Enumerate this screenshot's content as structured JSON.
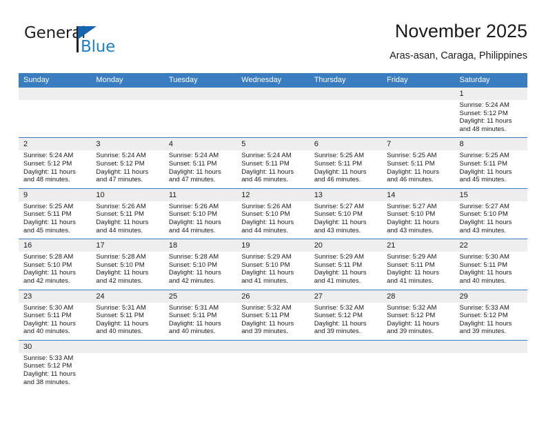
{
  "logo": {
    "primary_text": "General",
    "secondary_text": "Blue",
    "primary_color": "#231f20",
    "secondary_color": "#1f7fc4",
    "triangle_color": "#1565b0",
    "icon": "general-blue-logo"
  },
  "header": {
    "title": "November 2025",
    "subtitle": "Aras-asan, Caraga, Philippines"
  },
  "theme": {
    "header_bg": "#3a7dc1",
    "daynum_bg": "#eeeeee",
    "grid_line": "#3a7dc1",
    "text": "#1a1a1a"
  },
  "weekday_headers": [
    "Sunday",
    "Monday",
    "Tuesday",
    "Wednesday",
    "Thursday",
    "Friday",
    "Saturday"
  ],
  "weeks": [
    [
      {
        "day": "",
        "sunrise": "",
        "sunset": "",
        "daylight_line1": "",
        "daylight_line2": ""
      },
      {
        "day": "",
        "sunrise": "",
        "sunset": "",
        "daylight_line1": "",
        "daylight_line2": ""
      },
      {
        "day": "",
        "sunrise": "",
        "sunset": "",
        "daylight_line1": "",
        "daylight_line2": ""
      },
      {
        "day": "",
        "sunrise": "",
        "sunset": "",
        "daylight_line1": "",
        "daylight_line2": ""
      },
      {
        "day": "",
        "sunrise": "",
        "sunset": "",
        "daylight_line1": "",
        "daylight_line2": ""
      },
      {
        "day": "",
        "sunrise": "",
        "sunset": "",
        "daylight_line1": "",
        "daylight_line2": ""
      },
      {
        "day": "1",
        "sunrise": "Sunrise: 5:24 AM",
        "sunset": "Sunset: 5:12 PM",
        "daylight_line1": "Daylight: 11 hours",
        "daylight_line2": "and 48 minutes."
      }
    ],
    [
      {
        "day": "2",
        "sunrise": "Sunrise: 5:24 AM",
        "sunset": "Sunset: 5:12 PM",
        "daylight_line1": "Daylight: 11 hours",
        "daylight_line2": "and 48 minutes."
      },
      {
        "day": "3",
        "sunrise": "Sunrise: 5:24 AM",
        "sunset": "Sunset: 5:12 PM",
        "daylight_line1": "Daylight: 11 hours",
        "daylight_line2": "and 47 minutes."
      },
      {
        "day": "4",
        "sunrise": "Sunrise: 5:24 AM",
        "sunset": "Sunset: 5:11 PM",
        "daylight_line1": "Daylight: 11 hours",
        "daylight_line2": "and 47 minutes."
      },
      {
        "day": "5",
        "sunrise": "Sunrise: 5:24 AM",
        "sunset": "Sunset: 5:11 PM",
        "daylight_line1": "Daylight: 11 hours",
        "daylight_line2": "and 46 minutes."
      },
      {
        "day": "6",
        "sunrise": "Sunrise: 5:25 AM",
        "sunset": "Sunset: 5:11 PM",
        "daylight_line1": "Daylight: 11 hours",
        "daylight_line2": "and 46 minutes."
      },
      {
        "day": "7",
        "sunrise": "Sunrise: 5:25 AM",
        "sunset": "Sunset: 5:11 PM",
        "daylight_line1": "Daylight: 11 hours",
        "daylight_line2": "and 46 minutes."
      },
      {
        "day": "8",
        "sunrise": "Sunrise: 5:25 AM",
        "sunset": "Sunset: 5:11 PM",
        "daylight_line1": "Daylight: 11 hours",
        "daylight_line2": "and 45 minutes."
      }
    ],
    [
      {
        "day": "9",
        "sunrise": "Sunrise: 5:25 AM",
        "sunset": "Sunset: 5:11 PM",
        "daylight_line1": "Daylight: 11 hours",
        "daylight_line2": "and 45 minutes."
      },
      {
        "day": "10",
        "sunrise": "Sunrise: 5:26 AM",
        "sunset": "Sunset: 5:11 PM",
        "daylight_line1": "Daylight: 11 hours",
        "daylight_line2": "and 44 minutes."
      },
      {
        "day": "11",
        "sunrise": "Sunrise: 5:26 AM",
        "sunset": "Sunset: 5:10 PM",
        "daylight_line1": "Daylight: 11 hours",
        "daylight_line2": "and 44 minutes."
      },
      {
        "day": "12",
        "sunrise": "Sunrise: 5:26 AM",
        "sunset": "Sunset: 5:10 PM",
        "daylight_line1": "Daylight: 11 hours",
        "daylight_line2": "and 44 minutes."
      },
      {
        "day": "13",
        "sunrise": "Sunrise: 5:27 AM",
        "sunset": "Sunset: 5:10 PM",
        "daylight_line1": "Daylight: 11 hours",
        "daylight_line2": "and 43 minutes."
      },
      {
        "day": "14",
        "sunrise": "Sunrise: 5:27 AM",
        "sunset": "Sunset: 5:10 PM",
        "daylight_line1": "Daylight: 11 hours",
        "daylight_line2": "and 43 minutes."
      },
      {
        "day": "15",
        "sunrise": "Sunrise: 5:27 AM",
        "sunset": "Sunset: 5:10 PM",
        "daylight_line1": "Daylight: 11 hours",
        "daylight_line2": "and 43 minutes."
      }
    ],
    [
      {
        "day": "16",
        "sunrise": "Sunrise: 5:28 AM",
        "sunset": "Sunset: 5:10 PM",
        "daylight_line1": "Daylight: 11 hours",
        "daylight_line2": "and 42 minutes."
      },
      {
        "day": "17",
        "sunrise": "Sunrise: 5:28 AM",
        "sunset": "Sunset: 5:10 PM",
        "daylight_line1": "Daylight: 11 hours",
        "daylight_line2": "and 42 minutes."
      },
      {
        "day": "18",
        "sunrise": "Sunrise: 5:28 AM",
        "sunset": "Sunset: 5:10 PM",
        "daylight_line1": "Daylight: 11 hours",
        "daylight_line2": "and 42 minutes."
      },
      {
        "day": "19",
        "sunrise": "Sunrise: 5:29 AM",
        "sunset": "Sunset: 5:10 PM",
        "daylight_line1": "Daylight: 11 hours",
        "daylight_line2": "and 41 minutes."
      },
      {
        "day": "20",
        "sunrise": "Sunrise: 5:29 AM",
        "sunset": "Sunset: 5:11 PM",
        "daylight_line1": "Daylight: 11 hours",
        "daylight_line2": "and 41 minutes."
      },
      {
        "day": "21",
        "sunrise": "Sunrise: 5:29 AM",
        "sunset": "Sunset: 5:11 PM",
        "daylight_line1": "Daylight: 11 hours",
        "daylight_line2": "and 41 minutes."
      },
      {
        "day": "22",
        "sunrise": "Sunrise: 5:30 AM",
        "sunset": "Sunset: 5:11 PM",
        "daylight_line1": "Daylight: 11 hours",
        "daylight_line2": "and 40 minutes."
      }
    ],
    [
      {
        "day": "23",
        "sunrise": "Sunrise: 5:30 AM",
        "sunset": "Sunset: 5:11 PM",
        "daylight_line1": "Daylight: 11 hours",
        "daylight_line2": "and 40 minutes."
      },
      {
        "day": "24",
        "sunrise": "Sunrise: 5:31 AM",
        "sunset": "Sunset: 5:11 PM",
        "daylight_line1": "Daylight: 11 hours",
        "daylight_line2": "and 40 minutes."
      },
      {
        "day": "25",
        "sunrise": "Sunrise: 5:31 AM",
        "sunset": "Sunset: 5:11 PM",
        "daylight_line1": "Daylight: 11 hours",
        "daylight_line2": "and 40 minutes."
      },
      {
        "day": "26",
        "sunrise": "Sunrise: 5:32 AM",
        "sunset": "Sunset: 5:11 PM",
        "daylight_line1": "Daylight: 11 hours",
        "daylight_line2": "and 39 minutes."
      },
      {
        "day": "27",
        "sunrise": "Sunrise: 5:32 AM",
        "sunset": "Sunset: 5:12 PM",
        "daylight_line1": "Daylight: 11 hours",
        "daylight_line2": "and 39 minutes."
      },
      {
        "day": "28",
        "sunrise": "Sunrise: 5:32 AM",
        "sunset": "Sunset: 5:12 PM",
        "daylight_line1": "Daylight: 11 hours",
        "daylight_line2": "and 39 minutes."
      },
      {
        "day": "29",
        "sunrise": "Sunrise: 5:33 AM",
        "sunset": "Sunset: 5:12 PM",
        "daylight_line1": "Daylight: 11 hours",
        "daylight_line2": "and 39 minutes."
      }
    ],
    [
      {
        "day": "30",
        "sunrise": "Sunrise: 5:33 AM",
        "sunset": "Sunset: 5:12 PM",
        "daylight_line1": "Daylight: 11 hours",
        "daylight_line2": "and 38 minutes."
      },
      {
        "day": "",
        "sunrise": "",
        "sunset": "",
        "daylight_line1": "",
        "daylight_line2": ""
      },
      {
        "day": "",
        "sunrise": "",
        "sunset": "",
        "daylight_line1": "",
        "daylight_line2": ""
      },
      {
        "day": "",
        "sunrise": "",
        "sunset": "",
        "daylight_line1": "",
        "daylight_line2": ""
      },
      {
        "day": "",
        "sunrise": "",
        "sunset": "",
        "daylight_line1": "",
        "daylight_line2": ""
      },
      {
        "day": "",
        "sunrise": "",
        "sunset": "",
        "daylight_line1": "",
        "daylight_line2": ""
      },
      {
        "day": "",
        "sunrise": "",
        "sunset": "",
        "daylight_line1": "",
        "daylight_line2": ""
      }
    ]
  ]
}
